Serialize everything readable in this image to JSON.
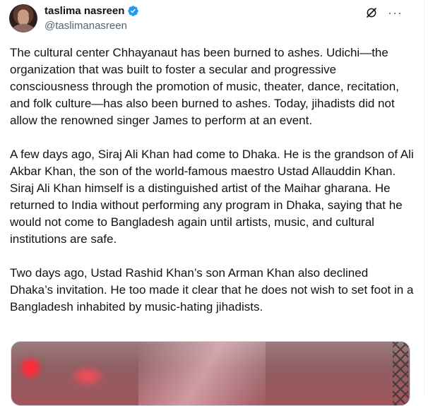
{
  "author": {
    "display_name": "taslima nasreen",
    "handle": "@taslimanasreen"
  },
  "icons": {
    "verified": "verified-badge-icon",
    "grok": "grok-icon",
    "more": "more-icon"
  },
  "colors": {
    "verified": "#1d9bf0",
    "text": "#0f1419",
    "muted": "#536471"
  },
  "actions": {
    "more_label": "···"
  },
  "tweet": {
    "paragraphs": [
      "The cultural center Chhayanaut has been burned to ashes. Udichi—the organization that was built to foster a secular and progressive consciousness through the promotion of music, theater, dance, recitation, and folk culture—has also been burned to ashes. Today, jihadists did not allow the renowned singer James to perform at an event.",
      "A few days ago, Siraj Ali Khan had come to Dhaka. He is the grandson of Ali Akbar Khan, the son of the world-famous maestro Ustad Allauddin Khan. Siraj Ali Khan himself is a distinguished artist of the Maihar gharana. He returned to India without performing any program in Dhaka, saying that he would not come to Bangladesh again until artists, music, and cultural institutions are safe.",
      "Two days ago, Ustad Rashid Khan’s son Arman Khan also declined Dhaka’s invitation. He too made it clear that he does not wish to set foot in a Bangladesh inhabited by music-hating jihadists."
    ]
  }
}
